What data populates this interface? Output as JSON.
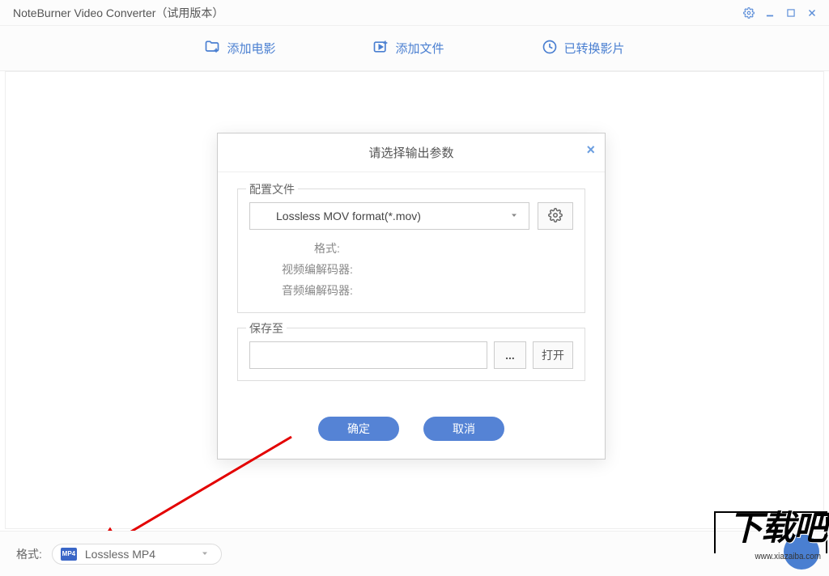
{
  "title": "NoteBurner Video Converter（试用版本）",
  "toolbar": {
    "add_movie": "添加电影",
    "add_file": "添加文件",
    "converted": "已转换影片"
  },
  "dialog": {
    "title": "请选择输出参数",
    "profile_legend": "配置文件",
    "selected_format": "Lossless MOV format(*.mov)",
    "format_label": "格式:",
    "video_codec_label": "视频编解码器:",
    "audio_codec_label": "音频编解码器:",
    "save_legend": "保存至",
    "browse": "...",
    "open": "打开",
    "ok": "确定",
    "cancel": "取消"
  },
  "bottom": {
    "format_label": "格式:",
    "format_badge": "MP4",
    "format_value": "Lossless MP4"
  },
  "watermark": {
    "text": "下载吧",
    "url": "www.xiazaiba.com"
  }
}
